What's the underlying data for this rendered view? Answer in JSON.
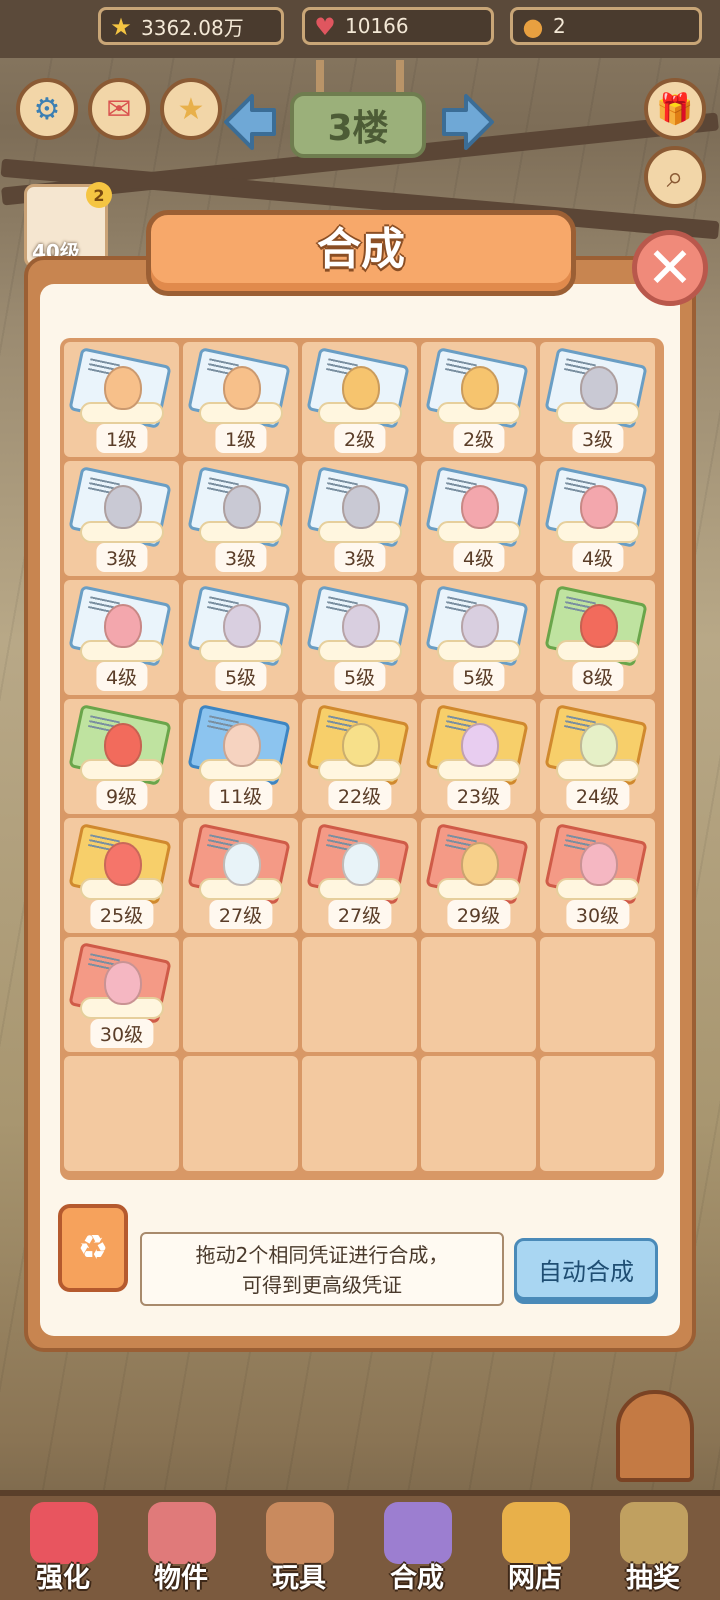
{
  "resources": [
    {
      "icon": "star-icon",
      "value": "3362.08万"
    },
    {
      "icon": "heart-icon",
      "value": "10166"
    },
    {
      "icon": "paw-coin-icon",
      "value": "2"
    }
  ],
  "floor": {
    "label": "3楼"
  },
  "avatar": {
    "level": "40级",
    "badge": "2"
  },
  "dialog": {
    "title": "合成",
    "hint_line1": "拖动2个相同凭证进行合成，",
    "hint_line2": "可得到更高级凭证",
    "auto_button": "自动合成"
  },
  "items": [
    {
      "level": "1级",
      "card": "blue",
      "egg": "#f7c08a"
    },
    {
      "level": "1级",
      "card": "blue",
      "egg": "#f7c08a"
    },
    {
      "level": "2级",
      "card": "blue",
      "egg": "#f6c46e"
    },
    {
      "level": "2级",
      "card": "blue",
      "egg": "#f6c46e"
    },
    {
      "level": "3级",
      "card": "blue",
      "egg": "#c9c9d4"
    },
    {
      "level": "3级",
      "card": "blue",
      "egg": "#c9c9d4"
    },
    {
      "level": "3级",
      "card": "blue",
      "egg": "#c9c9d4"
    },
    {
      "level": "3级",
      "card": "blue",
      "egg": "#c9c9d4"
    },
    {
      "level": "4级",
      "card": "blue",
      "egg": "#f3a7ad"
    },
    {
      "level": "4级",
      "card": "blue",
      "egg": "#f3a7ad"
    },
    {
      "level": "4级",
      "card": "blue",
      "egg": "#f3a7ad"
    },
    {
      "level": "5级",
      "card": "blue",
      "egg": "#d9cfe0"
    },
    {
      "level": "5级",
      "card": "blue",
      "egg": "#d9cfe0"
    },
    {
      "level": "5级",
      "card": "blue",
      "egg": "#d9cfe0"
    },
    {
      "level": "8级",
      "card": "green",
      "egg": "#f26b5c"
    },
    {
      "level": "9级",
      "card": "green",
      "egg": "#f26b5c"
    },
    {
      "level": "11级",
      "card": "sky",
      "egg": "#f6d3c0"
    },
    {
      "level": "22级",
      "card": "gold",
      "egg": "#f7e08a"
    },
    {
      "level": "23级",
      "card": "gold",
      "egg": "#e8cdf0"
    },
    {
      "level": "24级",
      "card": "gold",
      "egg": "#e6f0c7"
    },
    {
      "level": "25级",
      "card": "gold",
      "egg": "#f5756a"
    },
    {
      "level": "27级",
      "card": "red",
      "egg": "#e8f3f8"
    },
    {
      "level": "27级",
      "card": "red",
      "egg": "#e8f3f8"
    },
    {
      "level": "29级",
      "card": "red",
      "egg": "#f7d08a"
    },
    {
      "level": "30级",
      "card": "red",
      "egg": "#f5b7c2"
    },
    {
      "level": "30级",
      "card": "red",
      "egg": "#f5b7c2"
    }
  ],
  "nav": [
    {
      "label": "强化",
      "icon": "lollipop-icon",
      "color": "#e8555f"
    },
    {
      "label": "物件",
      "icon": "piano-icon",
      "color": "#e07a7a"
    },
    {
      "label": "玩具",
      "icon": "cat-house-icon",
      "color": "#c98a5e"
    },
    {
      "label": "合成",
      "icon": "card-merge-icon",
      "color": "#9c7ed0"
    },
    {
      "label": "网店",
      "icon": "basket-icon",
      "color": "#e8b04a"
    },
    {
      "label": "抽奖",
      "icon": "wheel-icon",
      "color": "#c0a060"
    }
  ]
}
